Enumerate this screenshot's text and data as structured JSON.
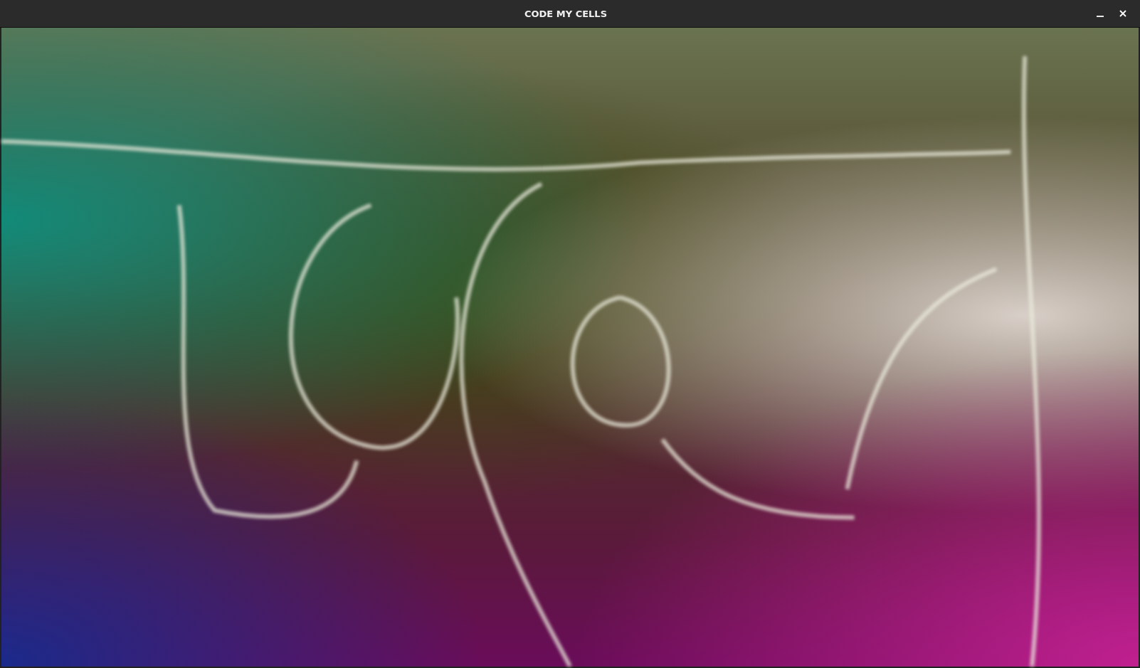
{
  "window": {
    "title": "CODE MY CELLS"
  },
  "content": {
    "kind": "image"
  }
}
